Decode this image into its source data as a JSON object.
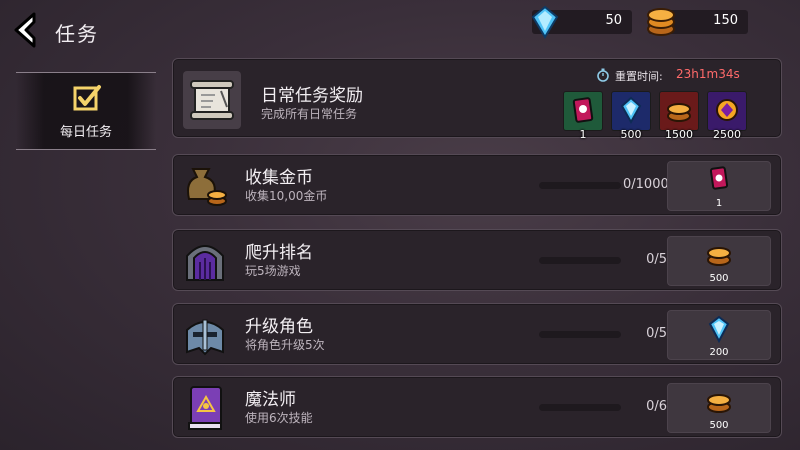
{
  "header": {
    "title": "任务",
    "gems": "50",
    "coins": "150"
  },
  "sidebar": {
    "tab_label": "每日任务"
  },
  "daily": {
    "title": "日常任务奖励",
    "desc": "完成所有日常任务",
    "reset_label": "重置时间:",
    "reset_time": "23h1m34s",
    "rewards": [
      {
        "value": "1",
        "kind": "card-icon",
        "color": "#1f5a3a"
      },
      {
        "value": "500",
        "kind": "gem-icon",
        "color": "#1d2a6a"
      },
      {
        "value": "1500",
        "kind": "coin-icon",
        "color": "#6a1a1a"
      },
      {
        "value": "2500",
        "kind": "purple-gem-icon",
        "color": "#3a1a6a"
      }
    ]
  },
  "tasks": [
    {
      "title": "收集金币",
      "desc": "收集10,00金币",
      "progress": "0/1000",
      "progress_fraction": 0,
      "reward": "1",
      "reward_icon": "card-icon"
    },
    {
      "title": "爬升排名",
      "desc": "玩5场游戏",
      "progress": "0/5",
      "progress_fraction": 0,
      "reward": "500",
      "reward_icon": "coin-icon"
    },
    {
      "title": "升级角色",
      "desc": "将角色升级5次",
      "progress": "0/5",
      "progress_fraction": 0,
      "reward": "200",
      "reward_icon": "gem-icon"
    },
    {
      "title": "魔法师",
      "desc": "使用6次技能",
      "progress": "0/6",
      "progress_fraction": 0,
      "reward": "500",
      "reward_icon": "coin-icon"
    }
  ]
}
